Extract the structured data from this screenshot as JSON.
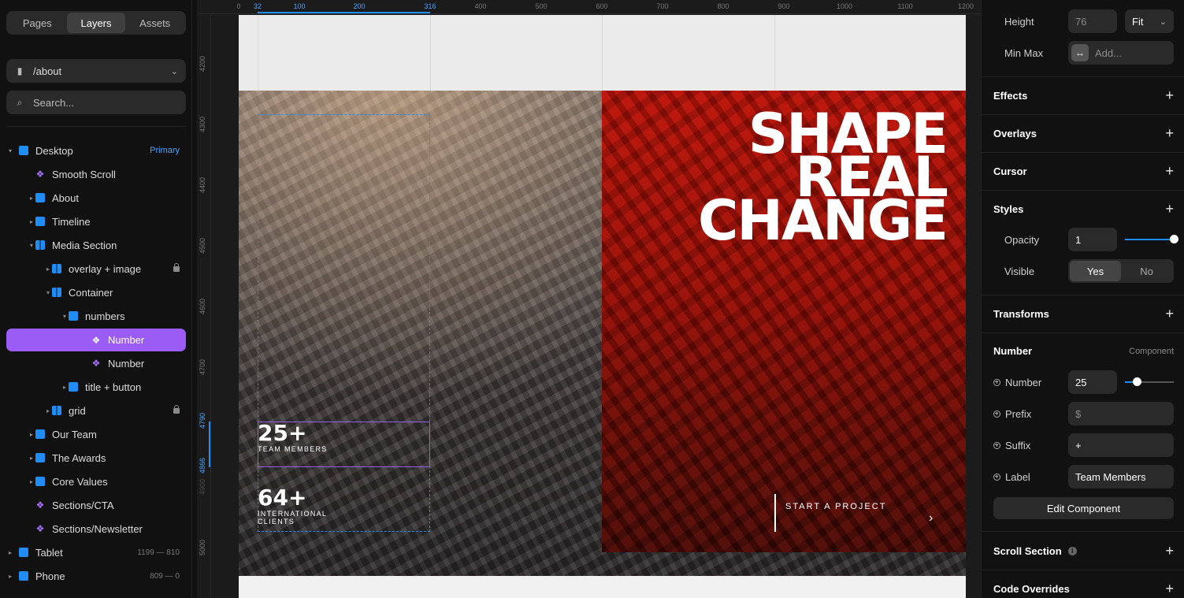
{
  "left": {
    "tabs": [
      "Pages",
      "Layers",
      "Assets"
    ],
    "active_tab": "Layers",
    "page_path": "/about",
    "search_placeholder": "Search...",
    "layers": [
      {
        "label": "Desktop",
        "badge": "Primary",
        "icon": "frame"
      },
      {
        "label": "Smooth Scroll",
        "icon": "component"
      },
      {
        "label": "About",
        "icon": "frame"
      },
      {
        "label": "Timeline",
        "icon": "frame"
      },
      {
        "label": "Media Section",
        "icon": "stack"
      },
      {
        "label": "overlay + image",
        "icon": "stack",
        "locked": true
      },
      {
        "label": "Container",
        "icon": "stack"
      },
      {
        "label": "numbers",
        "icon": "frame"
      },
      {
        "label": "Number",
        "icon": "component",
        "selected": true
      },
      {
        "label": "Number",
        "icon": "component"
      },
      {
        "label": "title + button",
        "icon": "frame"
      },
      {
        "label": "grid",
        "icon": "stack",
        "locked": true
      },
      {
        "label": "Our Team",
        "icon": "frame"
      },
      {
        "label": "The Awards",
        "icon": "frame"
      },
      {
        "label": "Core Values",
        "icon": "frame"
      },
      {
        "label": "Sections/CTA",
        "icon": "component"
      },
      {
        "label": "Sections/Newsletter",
        "icon": "component"
      },
      {
        "label": "Tablet",
        "dims": "1199 — 810",
        "icon": "frame"
      },
      {
        "label": "Phone",
        "dims": "809 — 0",
        "icon": "frame"
      }
    ]
  },
  "canvas": {
    "ruler_top": [
      "0",
      "32",
      "100",
      "200",
      "316",
      "400",
      "500",
      "600",
      "700",
      "800",
      "900",
      "1000",
      "1100",
      "1200"
    ],
    "ruler_left": [
      "4200",
      "4300",
      "4400",
      "4500",
      "4600",
      "4700",
      "4790",
      "4866",
      "4900",
      "5000"
    ],
    "headline": [
      "SHAPE",
      "REAL",
      "CHANGE"
    ],
    "stats": [
      {
        "value": "25+",
        "label": "TEAM MEMBERS"
      },
      {
        "value": "64+",
        "label": "INTERNATIONAL CLIENTS"
      }
    ],
    "cta_label": "START A PROJECT",
    "cta_arrow": "›"
  },
  "right": {
    "height_label": "Height",
    "height_value": "76",
    "height_mode": "Fit",
    "minmax_label": "Min Max",
    "minmax_placeholder": "Add...",
    "sections": [
      "Effects",
      "Overlays",
      "Cursor",
      "Styles",
      "Transforms"
    ],
    "opacity_label": "Opacity",
    "opacity_value": "1",
    "opacity_level": 1.0,
    "visible_label": "Visible",
    "visible_yes": "Yes",
    "visible_no": "No",
    "component_title": "Number",
    "component_tag": "Component",
    "props": [
      {
        "label": "Number",
        "value": "25"
      },
      {
        "label": "Prefix",
        "value": "$",
        "placeholder": true
      },
      {
        "label": "Suffix",
        "value": "+"
      },
      {
        "label": "Label",
        "value": "Team Members"
      }
    ],
    "number_level": 0.25,
    "edit_button": "Edit Component",
    "scroll_section": "Scroll Section",
    "code_overrides": "Code Overrides",
    "info_glyph": "i",
    "plus_glyph": "+"
  },
  "colors": {
    "accent_purple": "#9b5cf6",
    "accent_blue": "#1f8df5",
    "hero_red": "#b51208"
  }
}
